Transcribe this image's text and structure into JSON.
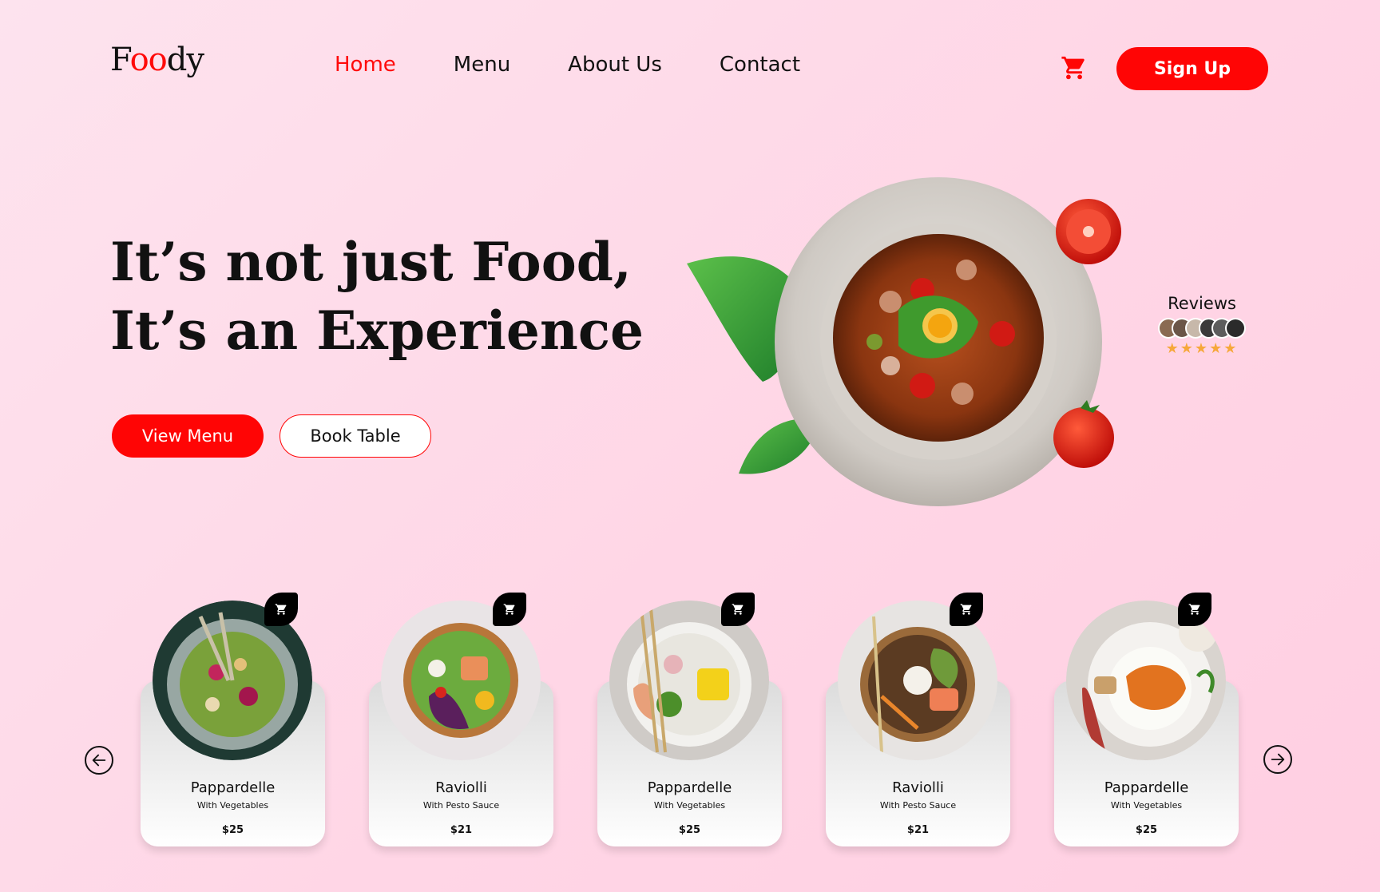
{
  "brand": {
    "logo_first": "F",
    "logo_accent": "oo",
    "logo_last": "dy"
  },
  "nav": {
    "home": "Home",
    "menu": "Menu",
    "about": "About Us",
    "contact": "Contact"
  },
  "header": {
    "signup_label": "Sign Up",
    "cart_icon": "cart-icon"
  },
  "hero": {
    "title_line1": "It’s not just Food,",
    "title_line2": "It’s an Experience",
    "view_menu_label": "View Menu",
    "book_table_label": "Book Table"
  },
  "reviews": {
    "label": "Reviews",
    "stars": "★★★★★",
    "rating_stars": 5
  },
  "products": [
    {
      "name": "Pappardelle",
      "subtitle": "With Vegetables",
      "price": "$25"
    },
    {
      "name": "Raviolli",
      "subtitle": "With Pesto Sauce",
      "price": "$21"
    },
    {
      "name": "Pappardelle",
      "subtitle": "With Vegetables",
      "price": "$25"
    },
    {
      "name": "Raviolli",
      "subtitle": "With Pesto Sauce",
      "price": "$21"
    },
    {
      "name": "Pappardelle",
      "subtitle": "With Vegetables",
      "price": "$25"
    }
  ],
  "colors": {
    "accent": "#ff0505",
    "background": "#ffd6e6",
    "star": "#f6a83a"
  }
}
